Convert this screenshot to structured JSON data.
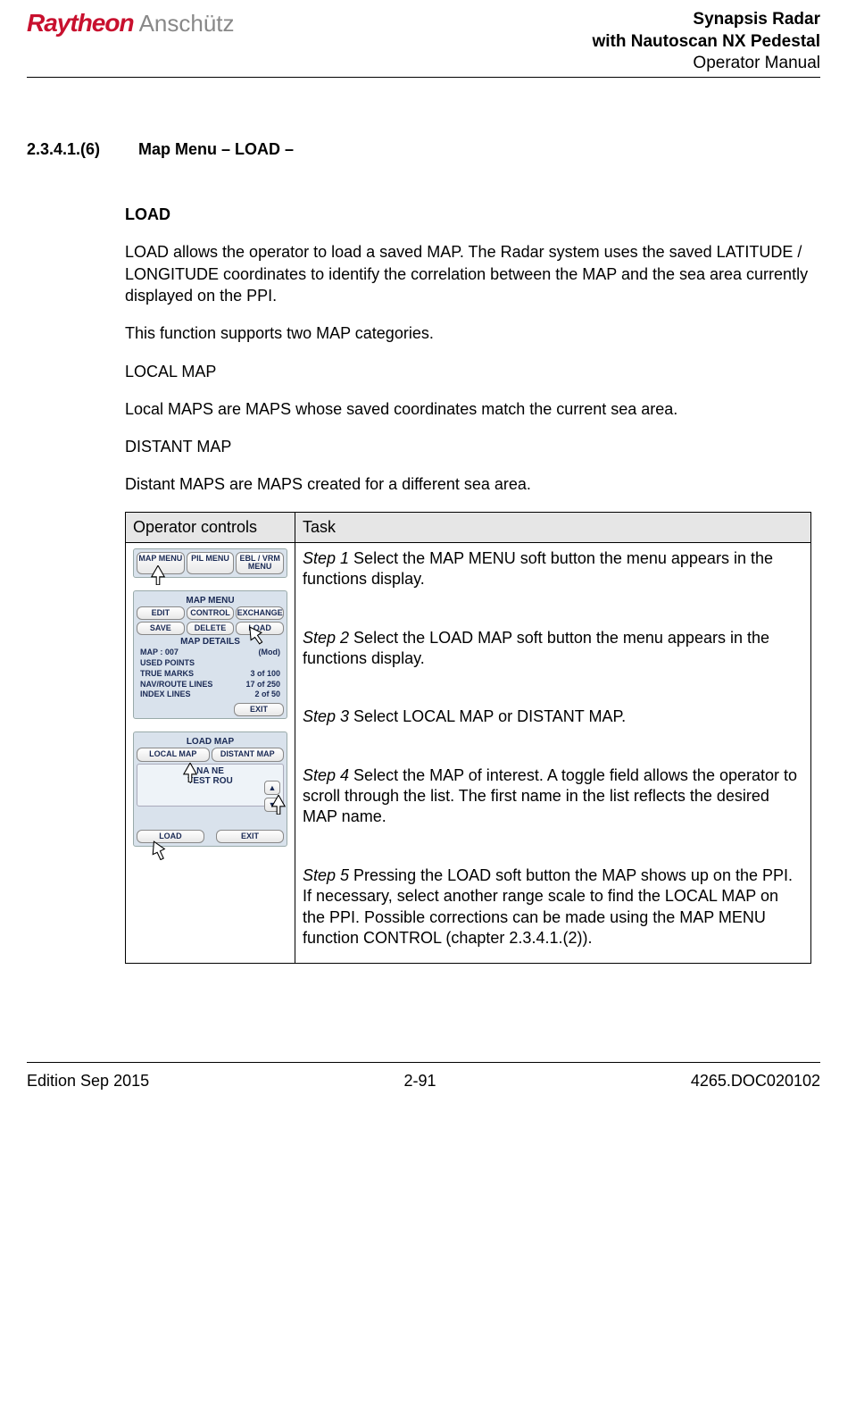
{
  "header": {
    "logo_brand": "Raytheon",
    "logo_sub": "Anschütz",
    "title_line1": "Synapsis Radar",
    "title_line2": "with Nautoscan NX Pedestal",
    "title_line3": "Operator Manual"
  },
  "section": {
    "number": "2.3.4.1.(6)",
    "title": "Map Menu – LOAD –"
  },
  "body": {
    "h_load": "LOAD",
    "p1": "LOAD allows the operator to load a saved MAP. The Radar system uses the saved LATITUDE / LONGITUDE coordinates to identify the correlation between the MAP and the sea area currently displayed on the PPI.",
    "p2": "This function supports two MAP categories.",
    "p3": "LOCAL MAP",
    "p4": "Local MAPS are MAPS whose saved coordinates match the current sea area.",
    "p5": "DISTANT MAP",
    "p6": "Distant MAPS are MAPS created for a different sea area."
  },
  "table": {
    "col1": "Operator controls",
    "col2": "Task",
    "steps": {
      "s1_label": "Step 1",
      "s1_text": " Select the MAP MENU soft button the menu appears in the functions display.",
      "s2_label": "Step 2",
      "s2_text": " Select the LOAD MAP soft button the menu appears in the functions display.",
      "s3_label": "Step 3",
      "s3_text": " Select LOCAL MAP or DISTANT MAP.",
      "s4_label": "Step 4",
      "s4_text": " Select the MAP of interest. A toggle field allows the operator to scroll through the list. The first name in the list reflects the desired MAP name.",
      "s5_label": "Step 5",
      "s5_text": " Pressing the LOAD soft button the MAP shows up on the PPI. If necessary, select another range scale to find the LOCAL MAP on the PPI. Possible corrections can be made using the MAP MENU function CONTROL (chapter 2.3.4.1.(2))."
    }
  },
  "ui": {
    "toolbar": {
      "map_menu": "MAP MENU",
      "pil_menu": "PIL MENU",
      "ebl_vrm": "EBL / VRM MENU"
    },
    "map_menu_panel": {
      "title": "MAP MENU",
      "edit": "EDIT",
      "control": "CONTROL",
      "exchange": "EXCHANGE",
      "save": "SAVE",
      "delete": "DELETE",
      "load": "LOAD",
      "details_title": "MAP DETAILS",
      "map_id_label": "MAP : 007",
      "map_id_suffix": "(Mod)",
      "used_points": "USED POINTS",
      "true_marks_label": "TRUE MARKS",
      "true_marks_val": "3  of   100",
      "nav_lines_label": "NAV/ROUTE LINES",
      "nav_lines_val": "17  of   250",
      "index_lines_label": "INDEX LINES",
      "index_lines_val": "2  of    50",
      "exit": "EXIT"
    },
    "load_map_panel": {
      "title": "LOAD MAP",
      "local": "LOCAL MAP",
      "distant": "DISTANT MAP",
      "item1": "NA    NE",
      "item2": "TEST ROU",
      "up": "▲",
      "down": "▼",
      "load": "LOAD",
      "exit": "EXIT"
    }
  },
  "footer": {
    "left": "Edition Sep 2015",
    "center": "2-91",
    "right": "4265.DOC020102"
  }
}
